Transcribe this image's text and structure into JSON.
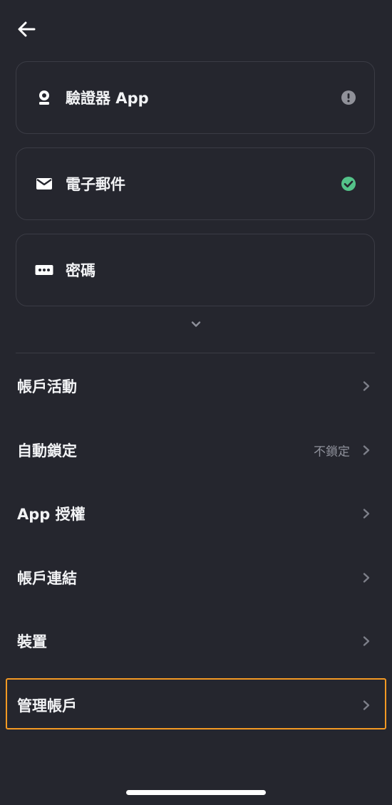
{
  "header": {
    "back_icon": "arrow-left-icon"
  },
  "methods": [
    {
      "label": "驗證器 App",
      "icon": "authenticator-icon",
      "status": "warning",
      "status_icon": "exclamation-circle-icon"
    },
    {
      "label": "電子郵件",
      "icon": "mail-icon",
      "status": "verified",
      "status_icon": "check-circle-icon"
    },
    {
      "label": "密碼",
      "icon": "password-icon",
      "status": "none"
    }
  ],
  "expand_icon": "chevron-down-icon",
  "menu": [
    {
      "label": "帳戶活動",
      "value": ""
    },
    {
      "label": "自動鎖定",
      "value": "不鎖定"
    },
    {
      "label": "App 授權",
      "value": ""
    },
    {
      "label": "帳戶連結",
      "value": ""
    },
    {
      "label": "裝置",
      "value": ""
    },
    {
      "label": "管理帳戶",
      "value": ""
    }
  ],
  "colors": {
    "background": "#25262e",
    "border": "#3b3c45",
    "text": "#f2f3f5",
    "secondary_text": "#8e909a",
    "warning_icon": "#909199",
    "success_icon": "#54c289",
    "highlight": "#f59a23"
  }
}
